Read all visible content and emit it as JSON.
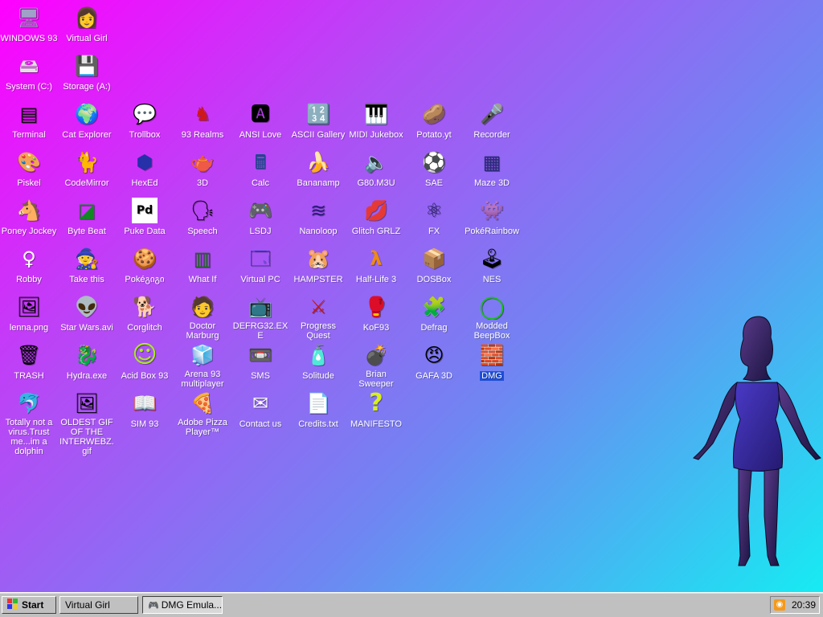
{
  "desktop": {
    "icons": [
      {
        "label": "WINDOWS 93",
        "icon": "computer-icon",
        "glyph": "🖥"
      },
      {
        "label": "Virtual Girl",
        "icon": "face-icon",
        "glyph": "👩"
      },
      {
        "label": "System (C:)",
        "icon": "drive-icon",
        "glyph": "🖴"
      },
      {
        "label": "Storage (A:)",
        "icon": "floppy-drive-icon",
        "glyph": "💾"
      },
      {
        "label": "Terminal",
        "icon": "terminal-icon",
        "glyph": "▤"
      },
      {
        "label": "Cat Explorer",
        "icon": "globe-icon",
        "glyph": "🌍"
      },
      {
        "label": "Trollbox",
        "icon": "chat-icon",
        "glyph": "💬"
      },
      {
        "label": "93 Realms",
        "icon": "knight-icon",
        "glyph": "♞"
      },
      {
        "label": "ANSI Love",
        "icon": "letter-a-icon",
        "glyph": "🅰"
      },
      {
        "label": "ASCII Gallery",
        "icon": "numbers-icon",
        "glyph": "🔢"
      },
      {
        "label": "MIDI Jukebox",
        "icon": "piano-icon",
        "glyph": "🎹"
      },
      {
        "label": "Potato.yt",
        "icon": "potato-icon",
        "glyph": "🥔"
      },
      {
        "label": "Recorder",
        "icon": "microphone-icon",
        "glyph": "🎤"
      },
      {
        "label": "Piskel",
        "icon": "palette-icon",
        "glyph": "🎨"
      },
      {
        "label": "CodeMirror",
        "icon": "cat-icon",
        "glyph": "🐈"
      },
      {
        "label": "HexEd",
        "icon": "cube-icon",
        "glyph": "⬢"
      },
      {
        "label": "3D",
        "icon": "teapot-icon",
        "glyph": "🫖"
      },
      {
        "label": "Calc",
        "icon": "calculator-icon",
        "glyph": "🖩"
      },
      {
        "label": "Bananamp",
        "icon": "banana-icon",
        "glyph": "🍌"
      },
      {
        "label": "G80.M3U",
        "icon": "audio-file-icon",
        "glyph": "🔈"
      },
      {
        "label": "SAE",
        "icon": "ball-icon",
        "glyph": "⚽"
      },
      {
        "label": "Maze 3D",
        "icon": "maze-icon",
        "glyph": "▦"
      },
      {
        "label": "Poney Jockey",
        "icon": "pony-icon",
        "glyph": "🐴"
      },
      {
        "label": "Byte Beat",
        "icon": "wave-icon",
        "glyph": "◪"
      },
      {
        "label": "Puke Data",
        "icon": "pd-icon",
        "glyph": "Pd"
      },
      {
        "label": "Speech",
        "icon": "speech-face-icon",
        "glyph": "🗣"
      },
      {
        "label": "LSDJ",
        "icon": "gameboy-icon",
        "glyph": "🎮"
      },
      {
        "label": "Nanoloop",
        "icon": "lines-icon",
        "glyph": "≋"
      },
      {
        "label": "Glitch GRLZ",
        "icon": "lips-icon",
        "glyph": "💋"
      },
      {
        "label": "FX",
        "icon": "atom-icon",
        "glyph": "⚛"
      },
      {
        "label": "PokéRainbow",
        "icon": "sprites-icon",
        "glyph": "👾"
      },
      {
        "label": "Robby",
        "icon": "stick-figure-icon",
        "glyph": "♀"
      },
      {
        "label": "Take this",
        "icon": "character-icon",
        "glyph": "🧙"
      },
      {
        "label": "Pokéგიგი",
        "icon": "cookie-icon",
        "glyph": "🍪"
      },
      {
        "label": "What If",
        "icon": "chart-icon",
        "glyph": "▥"
      },
      {
        "label": "Virtual PC",
        "icon": "window-icon",
        "glyph": "🗔"
      },
      {
        "label": "HAMPSTER",
        "icon": "hamster-icon",
        "glyph": "🐹"
      },
      {
        "label": "Half-Life 3",
        "icon": "lambda-icon",
        "glyph": "λ"
      },
      {
        "label": "DOSBox",
        "icon": "box-icon",
        "glyph": "📦"
      },
      {
        "label": "NES",
        "icon": "console-icon",
        "glyph": "🕹"
      },
      {
        "label": "lenna.png",
        "icon": "image-file-icon",
        "glyph": "🖼"
      },
      {
        "label": "Star Wars.avi",
        "icon": "yoda-icon",
        "glyph": "👽"
      },
      {
        "label": "Corglitch",
        "icon": "dog-icon",
        "glyph": "🐕"
      },
      {
        "label": "Doctor Marburg",
        "icon": "doctor-icon",
        "glyph": "🧑"
      },
      {
        "label": "DEFRG32.EXE",
        "icon": "monitor-face-icon",
        "glyph": "📺"
      },
      {
        "label": "Progress Quest",
        "icon": "swords-icon",
        "glyph": "⚔"
      },
      {
        "label": "KoF93",
        "icon": "fighter-icon",
        "glyph": "🥊"
      },
      {
        "label": "Defrag",
        "icon": "defrag-icon",
        "glyph": "🧩"
      },
      {
        "label": "Modded BeepBox",
        "icon": "ring-icon",
        "glyph": "◯"
      },
      {
        "label": "TRASH",
        "icon": "trash-icon",
        "glyph": "🗑"
      },
      {
        "label": "Hydra.exe",
        "icon": "dragon-icon",
        "glyph": "🐉"
      },
      {
        "label": "Acid Box 93",
        "icon": "smiley-icon",
        "glyph": "☺"
      },
      {
        "label": "Arena 93 multiplayer",
        "icon": "cube-3d-icon",
        "glyph": "🧊"
      },
      {
        "label": "SMS",
        "icon": "cartridge-icon",
        "glyph": "📼"
      },
      {
        "label": "Solitude",
        "icon": "bottle-icon",
        "glyph": "🧴"
      },
      {
        "label": "Brian Sweeper",
        "icon": "mine-icon",
        "glyph": "💣"
      },
      {
        "label": "GAFA 3D",
        "icon": "doom-face-icon",
        "glyph": "😠"
      },
      {
        "label": "DMG",
        "icon": "lego-icon",
        "glyph": "🧱",
        "selected": true
      },
      {
        "label": "Totally not a virus.Trust me...im a dolphin",
        "icon": "dolphin-icon",
        "glyph": "🐬"
      },
      {
        "label": "OLDEST GIF OF THE INTERWEBZ.gif",
        "icon": "gif-file-icon",
        "glyph": "🖼"
      },
      {
        "label": "SIM 93",
        "icon": "book-icon",
        "glyph": "📖"
      },
      {
        "label": "Adobe Pizza Player™",
        "icon": "pizza-icon",
        "glyph": "🍕"
      },
      {
        "label": "Contact us",
        "icon": "mail-icon",
        "glyph": "✉"
      },
      {
        "label": "Credits.txt",
        "icon": "text-file-icon",
        "glyph": "📄"
      },
      {
        "label": "MANIFESTO",
        "icon": "question-mark-icon",
        "glyph": "?"
      }
    ]
  },
  "taskbar": {
    "start_label": "Start",
    "tasks": [
      {
        "label": "Virtual Girl"
      },
      {
        "label": "DMG Emula..."
      }
    ],
    "clock": "20:39"
  },
  "colors": {
    "bg_magenta": "#ff00ff",
    "bg_cyan": "#12f0f2",
    "taskbar": "#c0c0c0",
    "selection": "#1f4fd8"
  }
}
